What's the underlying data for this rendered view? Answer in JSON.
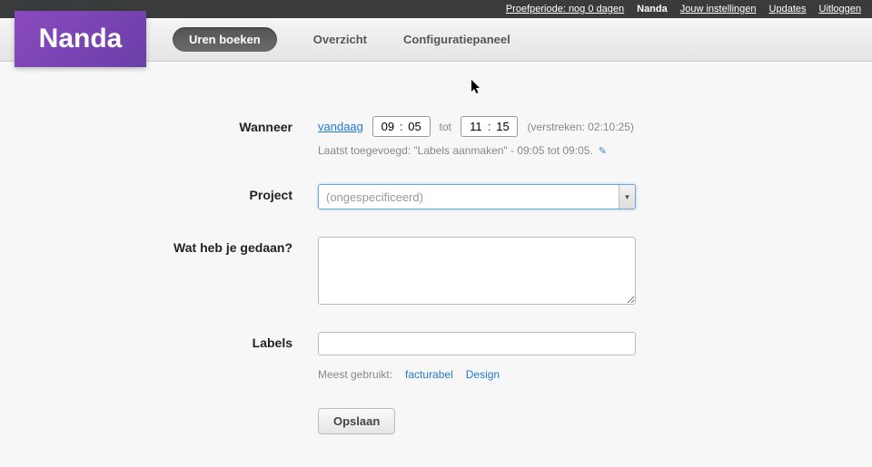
{
  "topbar": {
    "trial": "Proefperiode: nog 0 dagen",
    "user": "Nanda",
    "settings": "Jouw instellingen",
    "updates": "Updates",
    "logout": "Uitloggen"
  },
  "logo": "Nanda",
  "nav": {
    "book_hours": "Uren boeken",
    "overview": "Overzicht",
    "config": "Configuratiepaneel"
  },
  "form": {
    "when_label": "Wanneer",
    "today_link": "vandaag",
    "time_from_h": "09",
    "time_from_m": "05",
    "time_to_label": "tot",
    "time_to_h": "11",
    "time_to_m": "15",
    "elapsed": "(verstreken: 02:10:25)",
    "last_added": "Laatst toegevoegd: \"Labels aanmaken\" - 09:05 tot 09:05.",
    "project_label": "Project",
    "project_placeholder": "(ongespecificeerd)",
    "desc_label": "Wat heb je gedaan?",
    "labels_label": "Labels",
    "most_used_label": "Meest gebruikt:",
    "tag1": "facturabel",
    "tag2": "Design",
    "save": "Opslaan"
  }
}
